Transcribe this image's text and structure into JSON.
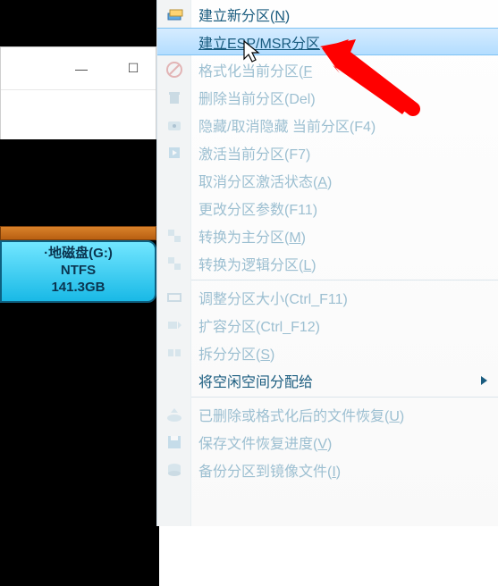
{
  "disk": {
    "label_line1": "·地磁盘(G:)",
    "label_line2": "NTFS",
    "label_line3": "141.3GB"
  },
  "titlebar": {
    "minimize": "—",
    "maximize": "☐"
  },
  "menu": {
    "items": [
      {
        "label": "建立新分区(",
        "shortcut": "N",
        "suffix": ")",
        "icon": "layers-icon",
        "enabled": true,
        "highlight": false
      },
      {
        "label": "建立ESP/MSR分区",
        "shortcut": "",
        "suffix": "",
        "icon": "blank-icon",
        "enabled": true,
        "highlight": true,
        "underline_all": true
      },
      {
        "label": "格式化当前分区(",
        "shortcut": "F",
        "suffix": "",
        "icon": "forbid-icon",
        "enabled": false,
        "highlight": false
      },
      {
        "label": "删除当前分区(Del)",
        "shortcut": "",
        "suffix": "",
        "icon": "delete-icon",
        "enabled": false,
        "highlight": false
      },
      {
        "label": "隐藏/取消隐藏 当前分区(F4)",
        "shortcut": "",
        "suffix": "",
        "icon": "hide-icon",
        "enabled": false,
        "highlight": false
      },
      {
        "label": "激活当前分区(F7)",
        "shortcut": "",
        "suffix": "",
        "icon": "activate-icon",
        "enabled": false,
        "highlight": false
      },
      {
        "label": "取消分区激活状态(",
        "shortcut": "A",
        "suffix": ")",
        "icon": "blank-icon",
        "enabled": false,
        "highlight": false
      },
      {
        "label": "更改分区参数(F11)",
        "shortcut": "",
        "suffix": "",
        "icon": "blank-icon",
        "enabled": false,
        "highlight": false
      },
      {
        "label": "转换为主分区(",
        "shortcut": "M",
        "suffix": ")",
        "icon": "convert-icon",
        "enabled": false,
        "highlight": false
      },
      {
        "label": "转换为逻辑分区(",
        "shortcut": "L",
        "suffix": ")",
        "icon": "convert-icon",
        "enabled": false,
        "highlight": false
      },
      {
        "sep": true
      },
      {
        "label": "调整分区大小(Ctrl_F11)",
        "shortcut": "",
        "suffix": "",
        "icon": "resize-icon",
        "enabled": false,
        "highlight": false
      },
      {
        "label": "扩容分区(Ctrl_F12)",
        "shortcut": "",
        "suffix": "",
        "icon": "expand-icon",
        "enabled": false,
        "highlight": false
      },
      {
        "label": "拆分分区(",
        "shortcut": "S",
        "suffix": ")",
        "icon": "split-icon",
        "enabled": false,
        "highlight": false
      },
      {
        "label": "将空闲空间分配给",
        "shortcut": "",
        "suffix": "",
        "icon": "blank-icon",
        "enabled": true,
        "highlight": false,
        "submenu": true
      },
      {
        "sep": true
      },
      {
        "label": "已删除或格式化后的文件恢复(",
        "shortcut": "U",
        "suffix": ")",
        "icon": "recover-icon",
        "enabled": false,
        "highlight": false
      },
      {
        "label": "保存文件恢复进度(",
        "shortcut": "V",
        "suffix": ")",
        "icon": "save-icon",
        "enabled": false,
        "highlight": false
      },
      {
        "label": "备份分区到镜像文件(",
        "shortcut": "I",
        "suffix": ")",
        "icon": "backup-icon",
        "enabled": false,
        "highlight": false
      }
    ]
  }
}
